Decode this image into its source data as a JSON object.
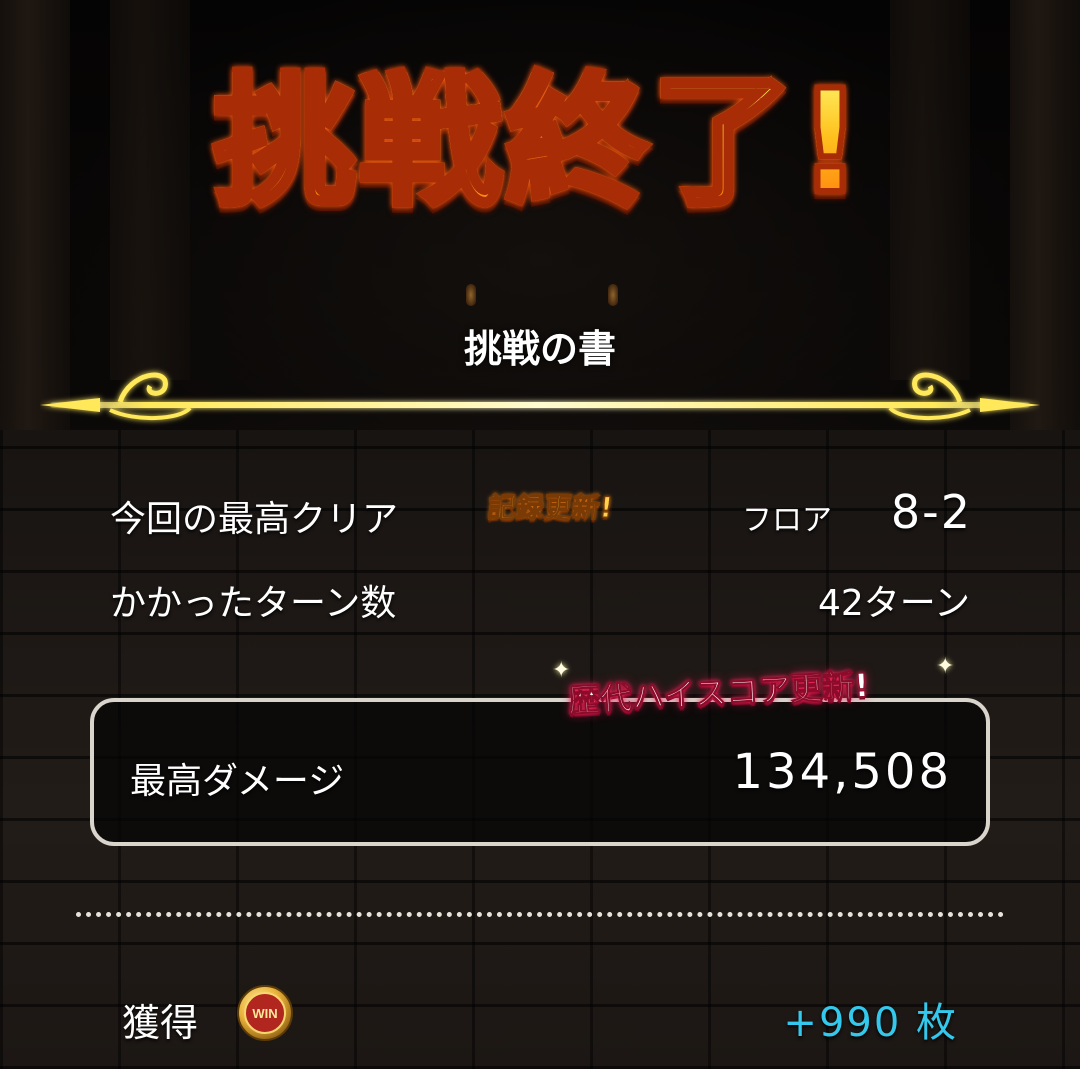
{
  "title": "挑戦終了!",
  "subtitle": "挑戦の書",
  "stats": {
    "best_clear_label": "今回の最高クリア",
    "record_badge": "記録更新!",
    "floor_prefix": "フロア",
    "floor_value": "8-2",
    "turns_label": "かかったターン数",
    "turns_value": "42ターン"
  },
  "high_score": {
    "badge": "歴代ハイスコア更新!",
    "label": "最高ダメージ",
    "value": "134,508"
  },
  "reward": {
    "label": "獲得",
    "coin_text": "WIN",
    "value": "+990 枚"
  },
  "colors": {
    "title_fill": "#ffc21f",
    "title_outline": "#a82d06",
    "record_badge": "#ffd24a",
    "alltime_badge_glow": "#ff2f66",
    "reward_value": "#33c8ec",
    "divider_gold": "#ffe85a"
  },
  "icons": {
    "divider": "ornate-gold-divider-icon",
    "coin": "win-medal-coin-icon",
    "sparkle": "sparkle-icon"
  }
}
